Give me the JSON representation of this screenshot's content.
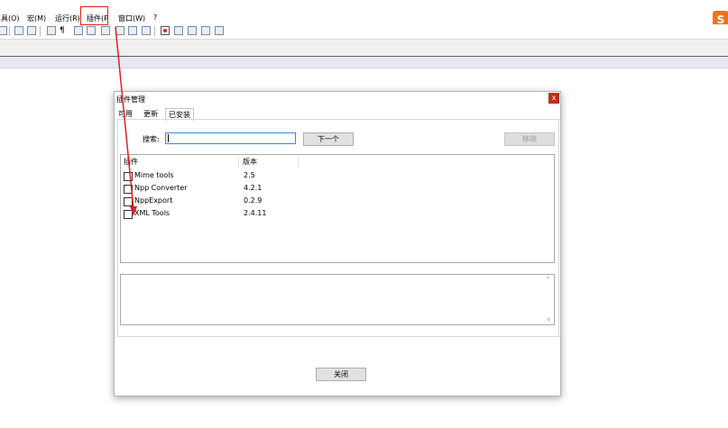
{
  "menubar": {
    "tools": "工具(O)",
    "macro": "宏(M)",
    "run": "运行(R)",
    "plugins": "插件(P",
    "window": "窗口(W)",
    "help": "?"
  },
  "logo": {
    "text": "S",
    "color": "#f0731c"
  },
  "dialog": {
    "title": "插件管理",
    "close_glyph": "x",
    "tabs": [
      "可用",
      "更新",
      "已安装"
    ],
    "selected_tab": "已安装",
    "search_label": "搜索:",
    "search_value": "",
    "next_button": "下一个",
    "remove_button": "移除",
    "columns": [
      "插件",
      "版本"
    ],
    "plugins": [
      {
        "name": "Mime tools",
        "version": "2.5",
        "checked": false
      },
      {
        "name": "Npp Converter",
        "version": "4.2.1",
        "checked": false
      },
      {
        "name": "NppExport",
        "version": "0.2.9",
        "checked": false
      },
      {
        "name": "XML Tools",
        "version": "2.4.11",
        "checked": false
      }
    ],
    "close_button": "关闭",
    "scroll_up": "^",
    "scroll_down": "v"
  },
  "annotation": {
    "color": "#e02020"
  }
}
